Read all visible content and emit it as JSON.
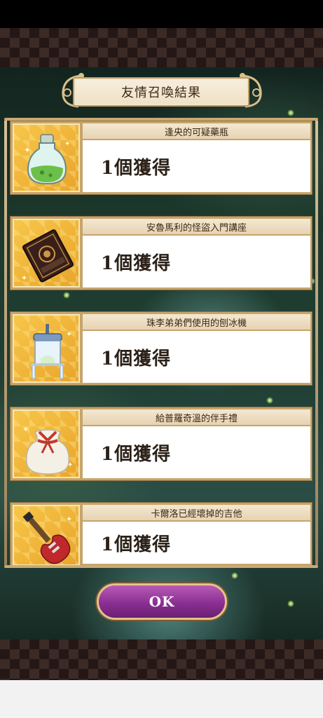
{
  "title": "友情召喚結果",
  "items": [
    {
      "name": "逢央的可疑藥瓶",
      "result": "1個獲得",
      "icon": "potion-bottle-icon"
    },
    {
      "name": "安魯馬利的怪盜入門講座",
      "result": "1個獲得",
      "icon": "book-icon"
    },
    {
      "name": "珠李弟弟們使用的刨冰機",
      "result": "1個獲得",
      "icon": "shaved-ice-machine-icon"
    },
    {
      "name": "給普羅奇溫的伴手禮",
      "result": "1個獲得",
      "icon": "gift-bag-icon"
    },
    {
      "name": "卡爾洛已經壞掉的吉他",
      "result": "1個獲得",
      "icon": "electric-guitar-icon"
    }
  ],
  "ok_button": "OK",
  "colors": {
    "frame": "#c7a46a",
    "icon_bg": "#f1b63a",
    "ok_button": "#8a2f92"
  }
}
